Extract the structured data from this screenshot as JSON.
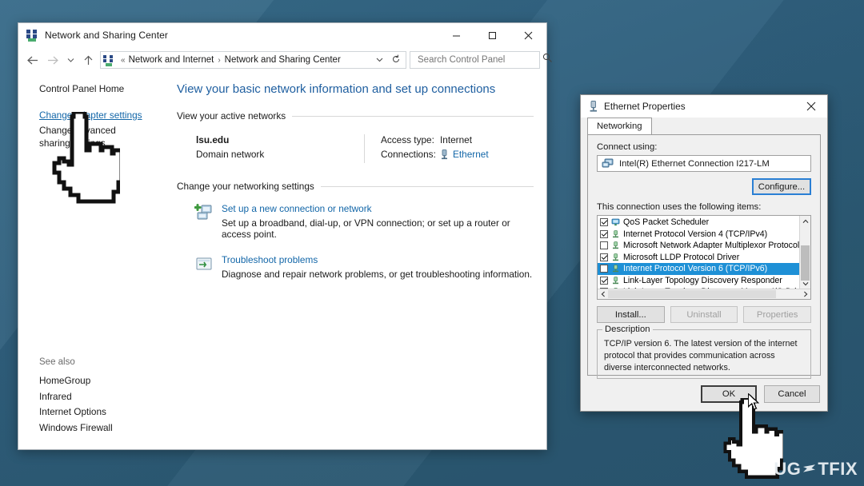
{
  "colors": {
    "desktop_bg": "#2f5f7d",
    "accent_link": "#1266a8",
    "heading_blue": "#1f5fa0",
    "selection_blue": "#1e90d6",
    "focus_blue": "#2a7fd4"
  },
  "control_panel": {
    "title": "Network and Sharing Center",
    "title_icon": "network-icon",
    "window_buttons": {
      "minimize": "minimize-icon",
      "maximize": "maximize-icon",
      "close": "close-icon"
    },
    "nav": {
      "back": "back-arrow-icon",
      "forward": "forward-arrow-icon",
      "recent": "chevron-down-icon",
      "up": "up-arrow-icon"
    },
    "address": {
      "icon": "network-icon",
      "prefix": "«",
      "crumb1": "Network and Internet",
      "separator": "›",
      "crumb2": "Network and Sharing Center",
      "dropdown": "chevron-down-icon",
      "refresh": "refresh-icon"
    },
    "search": {
      "placeholder": "Search Control Panel",
      "value": "",
      "icon": "search-icon"
    },
    "sidebar": {
      "home": "Control Panel Home",
      "links": [
        "Change adapter settings",
        "Change advanced sharing settings"
      ],
      "see_also_heading": "See also",
      "see_also": [
        "HomeGroup",
        "Infrared",
        "Internet Options",
        "Windows Firewall"
      ]
    },
    "main": {
      "heading": "View your basic network information and set up connections",
      "active_networks_heading": "View your active networks",
      "active_network": {
        "name": "lsu.edu",
        "type": "Domain network",
        "access_type_label": "Access type:",
        "access_type_value": "Internet",
        "connections_label": "Connections:",
        "connections_value": "Ethernet",
        "connections_icon": "ethernet-icon"
      },
      "change_settings_heading": "Change your networking settings",
      "settings_items": [
        {
          "icon": "new-connection-icon",
          "title": "Set up a new connection or network",
          "desc": "Set up a broadband, dial-up, or VPN connection; or set up a router or access point."
        },
        {
          "icon": "troubleshoot-icon",
          "title": "Troubleshoot problems",
          "desc": "Diagnose and repair network problems, or get troubleshooting information."
        }
      ]
    }
  },
  "ethernet_dialog": {
    "title": "Ethernet Properties",
    "title_icon": "ethernet-icon",
    "close_icon": "close-icon",
    "tabs": [
      {
        "label": "Networking",
        "active": true
      }
    ],
    "connect_using_label": "Connect using:",
    "adapter": {
      "icon": "network-adapter-icon",
      "name": "Intel(R) Ethernet Connection I217-LM"
    },
    "configure_button": "Configure...",
    "items_label": "This connection uses the following items:",
    "items": [
      {
        "label": "QoS Packet Scheduler",
        "checked": true,
        "selected": false,
        "icon": "qos-icon"
      },
      {
        "label": "Internet Protocol Version 4 (TCP/IPv4)",
        "checked": true,
        "selected": false,
        "icon": "protocol-icon"
      },
      {
        "label": "Microsoft Network Adapter Multiplexor Protocol",
        "checked": false,
        "selected": false,
        "icon": "protocol-icon"
      },
      {
        "label": "Microsoft LLDP Protocol Driver",
        "checked": true,
        "selected": false,
        "icon": "protocol-icon"
      },
      {
        "label": "Internet Protocol Version 6 (TCP/IPv6)",
        "checked": false,
        "selected": true,
        "icon": "protocol-icon"
      },
      {
        "label": "Link-Layer Topology Discovery Responder",
        "checked": true,
        "selected": false,
        "icon": "protocol-icon"
      },
      {
        "label": "Link-Layer Topology Discovery Mapper I/O Driver",
        "checked": true,
        "selected": false,
        "icon": "protocol-icon"
      }
    ],
    "scrollbars": {
      "up_icon": "chevron-up-icon",
      "down_icon": "chevron-down-icon",
      "left_icon": "chevron-left-icon",
      "right_icon": "chevron-right-icon"
    },
    "action_buttons": [
      {
        "label": "Install...",
        "enabled": true
      },
      {
        "label": "Uninstall",
        "enabled": false
      },
      {
        "label": "Properties",
        "enabled": false
      }
    ],
    "description_legend": "Description",
    "description_text": "TCP/IP version 6. The latest version of the internet protocol that provides communication across diverse interconnected networks.",
    "footer_buttons": {
      "ok": "OK",
      "cancel": "Cancel"
    }
  },
  "annotations": {
    "hand_cursor_sidebar": "pointing-hand-cursor",
    "hand_cursor_ok": "pointing-hand-cursor",
    "arrow_cursor_ok": "arrow-pointer-cursor"
  },
  "watermark": {
    "text_before": "UG",
    "mark": "≢",
    "text_after": "TFIX"
  }
}
